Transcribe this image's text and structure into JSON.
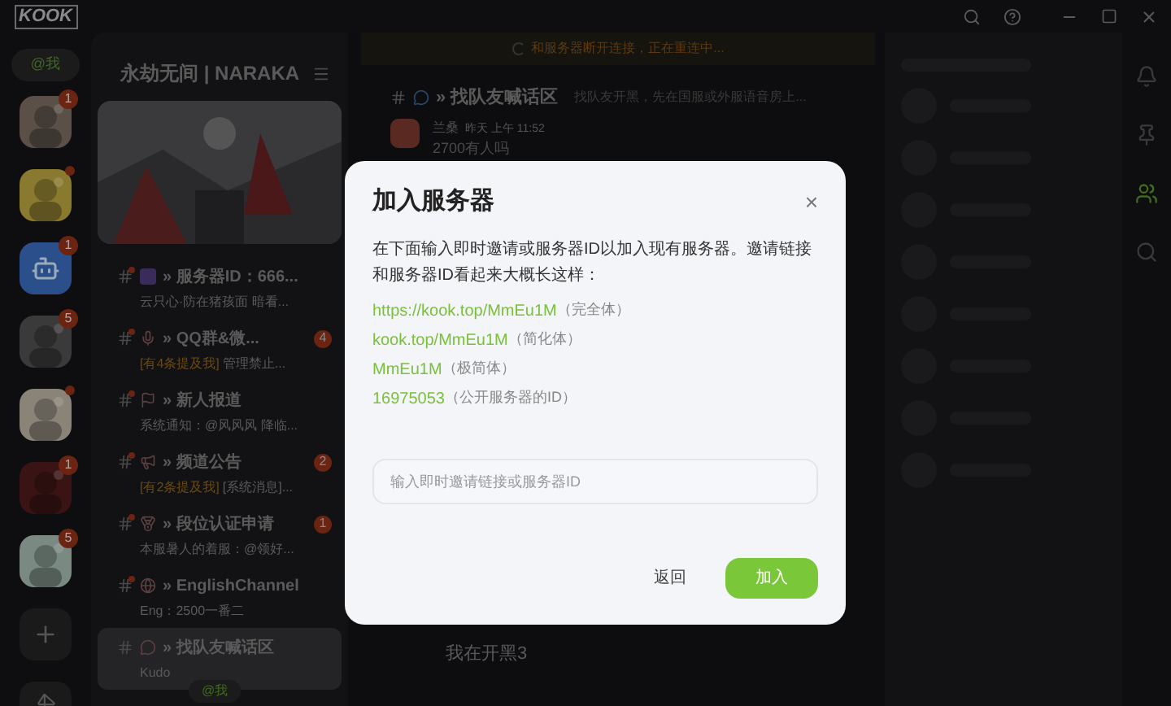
{
  "titlebar": {
    "logo": "KOOK"
  },
  "mention_pill": "@我",
  "servers": [
    {
      "kind": "picture",
      "badge": "1",
      "dot": false
    },
    {
      "kind": "picture",
      "dot": true
    },
    {
      "kind": "bot",
      "badge": "1",
      "dot": false
    },
    {
      "kind": "picture",
      "badge": "5",
      "dot": false
    },
    {
      "kind": "picture",
      "dot": true
    },
    {
      "kind": "picture",
      "badge": "1",
      "dot": false
    },
    {
      "kind": "picture",
      "badge": "5",
      "dot": false
    }
  ],
  "server_name": "永劫无间 | NARAKA",
  "channels": [
    {
      "kind": "id",
      "name": "» 服务器ID：666...",
      "preview": "云只心·防在猪孩面 暗看...",
      "unread": true,
      "selected": false
    },
    {
      "kind": "mic",
      "name": "» QQ群&微...",
      "mention": "[有4条提及我]",
      "preview": "管理禁止...",
      "badge": "4",
      "unread": true,
      "selected": false
    },
    {
      "kind": "flag",
      "name": "» 新人报道",
      "preview": "系统通知：@风风风 降临...",
      "unread": true,
      "selected": false
    },
    {
      "kind": "horn",
      "name": "» 频道公告",
      "mention": "[有2条提及我]",
      "preview": "[系统消息]...",
      "badge": "2",
      "unread": true,
      "selected": false
    },
    {
      "kind": "medal",
      "name": "» 段位认证申请",
      "preview": "本服暑人的着服：@领好...",
      "badge": "1",
      "unread": true,
      "selected": false
    },
    {
      "kind": "globe",
      "name": "» EnglishChannel",
      "preview": "Eng：2500一番二",
      "unread": true,
      "selected": false
    },
    {
      "kind": "chat",
      "name": "» 找队友喊话区",
      "preview": "Kudo",
      "unread": false,
      "selected": true
    }
  ],
  "bottom_pill": "@我",
  "banner": "和服务器断开连接，正在重连中...",
  "channel_header": {
    "name": "» 找队友喊话区",
    "topic": "找队友开黑，先在国服或外服语音房上..."
  },
  "messages": [
    {
      "author": "兰桑",
      "time": "昨天 上午 11:52",
      "text": "2700有人吗"
    }
  ],
  "last_message": "我在开黑3",
  "dialog": {
    "title": "加入服务器",
    "close": "×",
    "description": "在下面输入即时邀请或服务器ID以加入现有服务器。邀请链接和服务器ID看起来大概长这样：",
    "examples": [
      {
        "code": "https://kook.top/MmEu1M",
        "note": "（完全体）"
      },
      {
        "code": "kook.top/MmEu1M",
        "note": "（简化体）"
      },
      {
        "code": "MmEu1M",
        "note": "（极简体）"
      },
      {
        "code": "16975053",
        "note": "（公开服务器的ID）"
      }
    ],
    "input_placeholder": "输入即时邀请链接或服务器ID",
    "cancel": "返回",
    "confirm": "加入"
  },
  "right_tools": [
    {
      "kind": "bell",
      "selected": false
    },
    {
      "kind": "pin",
      "selected": false
    },
    {
      "kind": "users",
      "selected": true
    },
    {
      "kind": "search",
      "selected": false
    }
  ]
}
